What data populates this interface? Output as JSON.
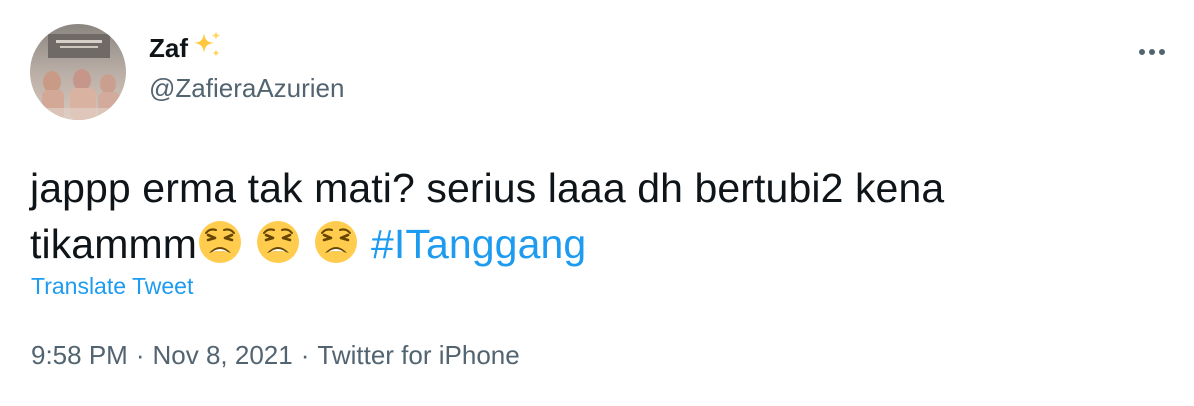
{
  "author": {
    "display_name": "Zaf",
    "badge_icon": "sparkles-icon",
    "handle": "@ZafieraAzurien",
    "avatar_icon": "profile-photo"
  },
  "menu": {
    "more_icon": "more-horizontal-icon"
  },
  "tweet": {
    "text_line1": "jappp erma tak mati? serius laaa dh bertubi2 kena",
    "text_line2": "tikammm",
    "emoji_name": "weary-face-emoji",
    "emoji_count": 3,
    "hashtag": "#ITanggang"
  },
  "translate_label": "Translate Tweet",
  "meta": {
    "time": "9:58 PM",
    "separator": "·",
    "date": "Nov 8, 2021",
    "source": "Twitter for iPhone"
  },
  "colors": {
    "link": "#1d9bf0",
    "secondary_text": "#536471",
    "primary_text": "#0f1419"
  }
}
